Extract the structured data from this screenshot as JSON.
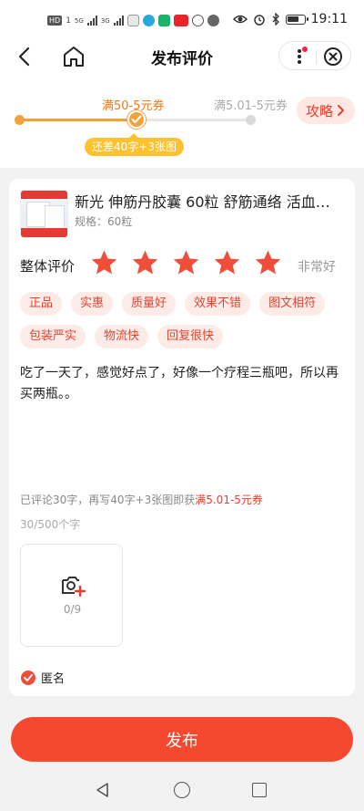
{
  "status_bar": {
    "time": "19:11",
    "hd_label": "HD",
    "network_label_1": "5G",
    "network_label_2": "3G"
  },
  "header": {
    "title": "发布评价"
  },
  "progress": {
    "current_coupon": "满50-5元券",
    "next_coupon": "满5.01-5元券",
    "hint": "还差40字+3张图",
    "strategy_label": "攻略",
    "fill_fraction": 0.5
  },
  "product": {
    "title": "新光 伸筋丹胶囊 60粒 舒筋通络 活血…",
    "spec": "规格：60粒"
  },
  "rating": {
    "label": "整体评价",
    "stars": 5,
    "max_stars": 5,
    "text": "非常好"
  },
  "tags": [
    "正品",
    "实惠",
    "质量好",
    "效果不错",
    "图文相符",
    "包装严实",
    "物流快",
    "回复很快"
  ],
  "review": {
    "text": "吃了一天了，感觉好点了，好像一个疗程三瓶吧，所以再买两瓶。。",
    "reward_prefix": "已评论30字，再写40字+3张图即获",
    "reward_highlight": "满5.01-5元券",
    "char_count": "30/500个字"
  },
  "upload": {
    "count": "0/9"
  },
  "anonymous": {
    "label": "匿名",
    "checked": true
  },
  "publish": {
    "label": "发布"
  },
  "colors": {
    "accent": "#f5492f",
    "star": "#ee4e3a",
    "progress": "#f2a23c",
    "hint_pill": "#ffc12e"
  }
}
